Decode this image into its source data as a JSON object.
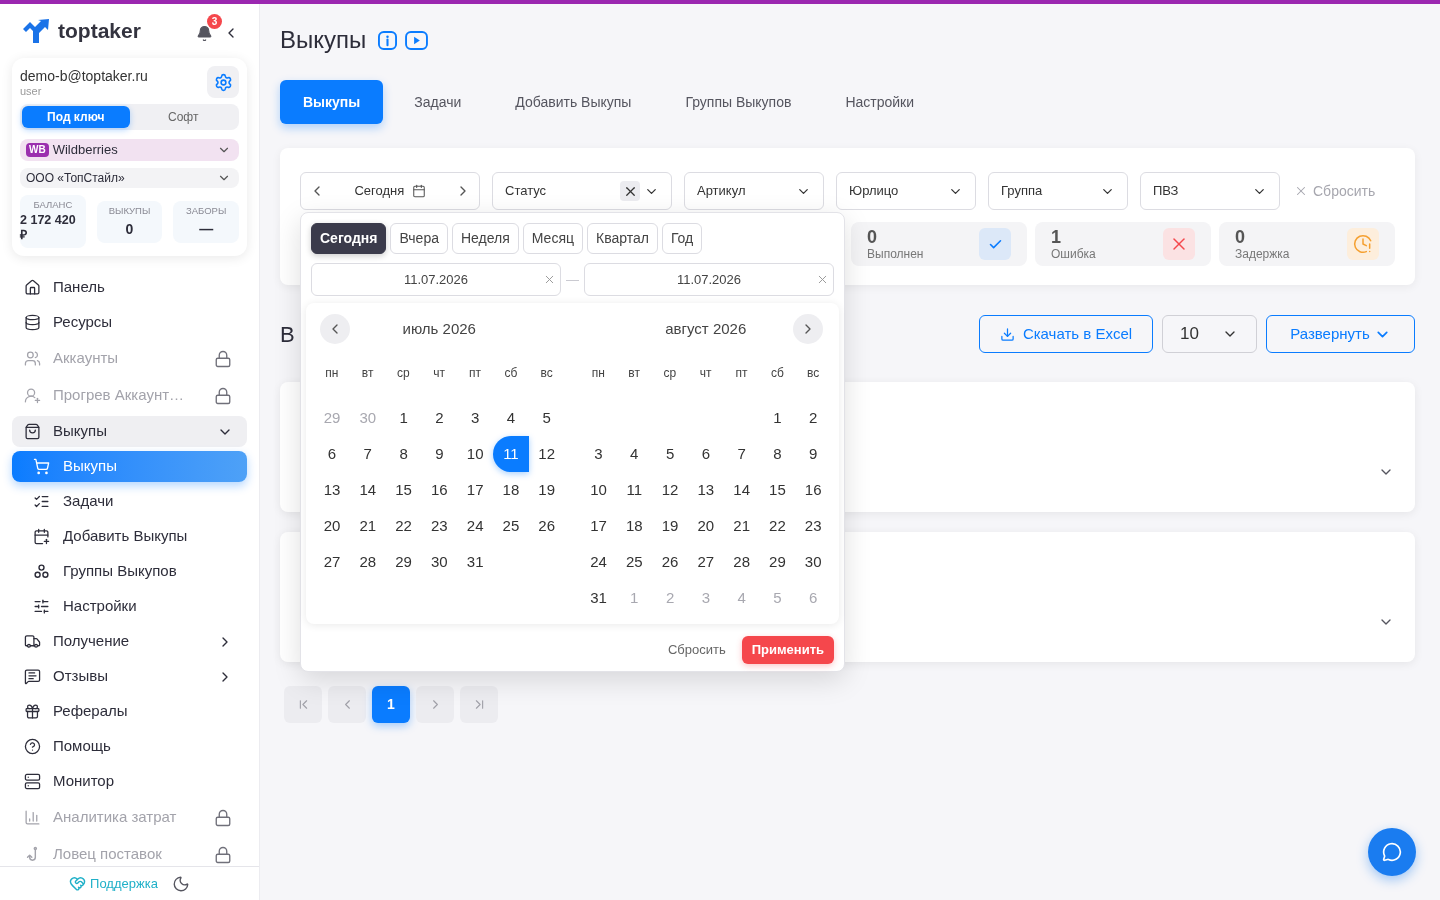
{
  "sidebar": {
    "logo": "toptaker",
    "notifications_badge": "3",
    "account": {
      "email": "demo-b@toptaker.ru",
      "role": "user"
    },
    "mode_toggle": [
      {
        "label": "Под ключ",
        "selected": true
      },
      {
        "label": "Софт",
        "selected": false
      }
    ],
    "marketplace": {
      "badge": "WB",
      "value": "Wildberries"
    },
    "company": {
      "value": "ООО «ТопСтайл»"
    },
    "stats": [
      {
        "label": "БАЛАНС",
        "value": "2 172 420 ₽"
      },
      {
        "label": "ВЫКУПЫ",
        "value": "0"
      },
      {
        "label": "ЗАБОРЫ",
        "value": "—"
      }
    ],
    "nav": [
      {
        "label": "Панель",
        "kind": "link",
        "selected": false,
        "disabled": false
      },
      {
        "label": "Ресурсы",
        "kind": "link",
        "selected": false,
        "disabled": false
      },
      {
        "label": "Аккаунты",
        "kind": "link",
        "selected": false,
        "disabled": true
      },
      {
        "label": "Прогрев Аккаунт…",
        "kind": "link",
        "selected": false,
        "disabled": true
      },
      {
        "label": "Выкупы",
        "kind": "group",
        "expanded": true,
        "selected": false,
        "disabled": false,
        "children": [
          {
            "label": "Выкупы",
            "selected": true
          },
          {
            "label": "Задачи",
            "selected": false
          },
          {
            "label": "Добавить Выкупы",
            "selected": false
          },
          {
            "label": "Группы Выкупов",
            "selected": false
          },
          {
            "label": "Настройки",
            "selected": false
          }
        ]
      },
      {
        "label": "Получение",
        "kind": "group",
        "expanded": false,
        "selected": false,
        "disabled": false
      },
      {
        "label": "Отзывы",
        "kind": "group",
        "expanded": false,
        "selected": false,
        "disabled": false
      },
      {
        "label": "Рефералы",
        "kind": "link",
        "selected": false,
        "disabled": false
      },
      {
        "label": "Помощь",
        "kind": "link",
        "selected": false,
        "disabled": false
      },
      {
        "label": "Монитор",
        "kind": "link",
        "selected": false,
        "disabled": false
      },
      {
        "label": "Аналитика затрат",
        "kind": "link",
        "selected": false,
        "disabled": true
      },
      {
        "label": "Ловец поставок",
        "kind": "link",
        "selected": false,
        "disabled": true
      }
    ],
    "support_link": "Поддержка"
  },
  "page_title": "Выкупы",
  "tabs": [
    {
      "label": "Выкупы",
      "selected": true
    },
    {
      "label": "Задачи",
      "selected": false
    },
    {
      "label": "Добавить Выкупы",
      "selected": false
    },
    {
      "label": "Группы Выкупов",
      "selected": false
    },
    {
      "label": "Настройки",
      "selected": false
    }
  ],
  "filters": {
    "date_range": {
      "value": "Сегодня"
    },
    "selects": [
      {
        "label": "Статус",
        "clearable": true
      },
      {
        "label": "Артикул",
        "clearable": false
      },
      {
        "label": "Юрлицо",
        "clearable": false
      },
      {
        "label": "Группа",
        "clearable": false
      },
      {
        "label": "ПВЗ",
        "clearable": false
      }
    ],
    "reset": "Сбросить"
  },
  "status_cards": [
    {
      "kind": "done",
      "count": "0",
      "label": "Выполнен"
    },
    {
      "kind": "error",
      "count": "1",
      "label": "Ошибка"
    },
    {
      "kind": "delay",
      "count": "0",
      "label": "Задержка"
    }
  ],
  "section": {
    "title": "В",
    "export_button": "Скачать в Excel",
    "page_size": "10",
    "expand_button": "Развернуть"
  },
  "list_cards": [
    {
      "expanded": false
    },
    {
      "expanded": false
    }
  ],
  "pagination": {
    "pages": [
      {
        "label": "1",
        "selected": true
      }
    ]
  },
  "date_picker": {
    "presets": [
      {
        "label": "Сегодня",
        "selected": true
      },
      {
        "label": "Вчера",
        "selected": false
      },
      {
        "label": "Неделя",
        "selected": false
      },
      {
        "label": "Месяц",
        "selected": false
      },
      {
        "label": "Квартал",
        "selected": false
      },
      {
        "label": "Год",
        "selected": false
      }
    ],
    "start": "11.07.2026",
    "separator": "—",
    "end": "11.07.2026",
    "months": [
      {
        "title": "июль 2026",
        "weekdays": [
          "пн",
          "вт",
          "ср",
          "чт",
          "пт",
          "сб",
          "вс"
        ],
        "weeks": [
          [
            {
              "label": "29",
              "outside": true,
              "selected": false
            },
            {
              "label": "30",
              "outside": true,
              "selected": false
            },
            {
              "label": "1",
              "outside": false,
              "selected": false
            },
            {
              "label": "2",
              "outside": false,
              "selected": false
            },
            {
              "label": "3",
              "outside": false,
              "selected": false
            },
            {
              "label": "4",
              "outside": false,
              "selected": false
            },
            {
              "label": "5",
              "outside": false,
              "selected": false
            }
          ],
          [
            {
              "label": "6",
              "outside": false,
              "selected": false
            },
            {
              "label": "7",
              "outside": false,
              "selected": false
            },
            {
              "label": "8",
              "outside": false,
              "selected": false
            },
            {
              "label": "9",
              "outside": false,
              "selected": false
            },
            {
              "label": "10",
              "outside": false,
              "selected": false
            },
            {
              "label": "11",
              "outside": false,
              "selected": true
            },
            {
              "label": "12",
              "outside": false,
              "selected": false
            }
          ],
          [
            {
              "label": "13",
              "outside": false,
              "selected": false
            },
            {
              "label": "14",
              "outside": false,
              "selected": false
            },
            {
              "label": "15",
              "outside": false,
              "selected": false
            },
            {
              "label": "16",
              "outside": false,
              "selected": false
            },
            {
              "label": "17",
              "outside": false,
              "selected": false
            },
            {
              "label": "18",
              "outside": false,
              "selected": false
            },
            {
              "label": "19",
              "outside": false,
              "selected": false
            }
          ],
          [
            {
              "label": "20",
              "outside": false,
              "selected": false
            },
            {
              "label": "21",
              "outside": false,
              "selected": false
            },
            {
              "label": "22",
              "outside": false,
              "selected": false
            },
            {
              "label": "23",
              "outside": false,
              "selected": false
            },
            {
              "label": "24",
              "outside": false,
              "selected": false
            },
            {
              "label": "25",
              "outside": false,
              "selected": false
            },
            {
              "label": "26",
              "outside": false,
              "selected": false
            }
          ],
          [
            {
              "label": "27",
              "outside": false,
              "selected": false
            },
            {
              "label": "28",
              "outside": false,
              "selected": false
            },
            {
              "label": "29",
              "outside": false,
              "selected": false
            },
            {
              "label": "30",
              "outside": false,
              "selected": false
            },
            {
              "label": "31",
              "outside": false,
              "selected": false
            }
          ]
        ]
      },
      {
        "title": "август 2026",
        "weekdays": [
          "пн",
          "вт",
          "ср",
          "чт",
          "пт",
          "сб",
          "вс"
        ],
        "weeks": [
          [
            {
              "label": "1",
              "outside": false,
              "selected": false
            },
            {
              "label": "2",
              "outside": false,
              "selected": false
            }
          ],
          [
            {
              "label": "3",
              "outside": false,
              "selected": false
            },
            {
              "label": "4",
              "outside": false,
              "selected": false
            },
            {
              "label": "5",
              "outside": false,
              "selected": false
            },
            {
              "label": "6",
              "outside": false,
              "selected": false
            },
            {
              "label": "7",
              "outside": false,
              "selected": false
            },
            {
              "label": "8",
              "outside": false,
              "selected": false
            },
            {
              "label": "9",
              "outside": false,
              "selected": false
            }
          ],
          [
            {
              "label": "10",
              "outside": false,
              "selected": false
            },
            {
              "label": "11",
              "outside": false,
              "selected": false
            },
            {
              "label": "12",
              "outside": false,
              "selected": false
            },
            {
              "label": "13",
              "outside": false,
              "selected": false
            },
            {
              "label": "14",
              "outside": false,
              "selected": false
            },
            {
              "label": "15",
              "outside": false,
              "selected": false
            },
            {
              "label": "16",
              "outside": false,
              "selected": false
            }
          ],
          [
            {
              "label": "17",
              "outside": false,
              "selected": false
            },
            {
              "label": "18",
              "outside": false,
              "selected": false
            },
            {
              "label": "19",
              "outside": false,
              "selected": false
            },
            {
              "label": "20",
              "outside": false,
              "selected": false
            },
            {
              "label": "21",
              "outside": false,
              "selected": false
            },
            {
              "label": "22",
              "outside": false,
              "selected": false
            },
            {
              "label": "23",
              "outside": false,
              "selected": false
            }
          ],
          [
            {
              "label": "24",
              "outside": false,
              "selected": false
            },
            {
              "label": "25",
              "outside": false,
              "selected": false
            },
            {
              "label": "26",
              "outside": false,
              "selected": false
            },
            {
              "label": "27",
              "outside": false,
              "selected": false
            },
            {
              "label": "28",
              "outside": false,
              "selected": false
            },
            {
              "label": "29",
              "outside": false,
              "selected": false
            },
            {
              "label": "30",
              "outside": false,
              "selected": false
            }
          ],
          [
            {
              "label": "31",
              "outside": false,
              "selected": false
            },
            {
              "label": "1",
              "outside": true,
              "selected": false
            },
            {
              "label": "2",
              "outside": true,
              "selected": false
            },
            {
              "label": "3",
              "outside": true,
              "selected": false
            },
            {
              "label": "4",
              "outside": true,
              "selected": false
            },
            {
              "label": "5",
              "outside": true,
              "selected": false
            },
            {
              "label": "6",
              "outside": true,
              "selected": false
            }
          ]
        ]
      }
    ],
    "reset": "Сбросить",
    "apply": "Применить"
  }
}
